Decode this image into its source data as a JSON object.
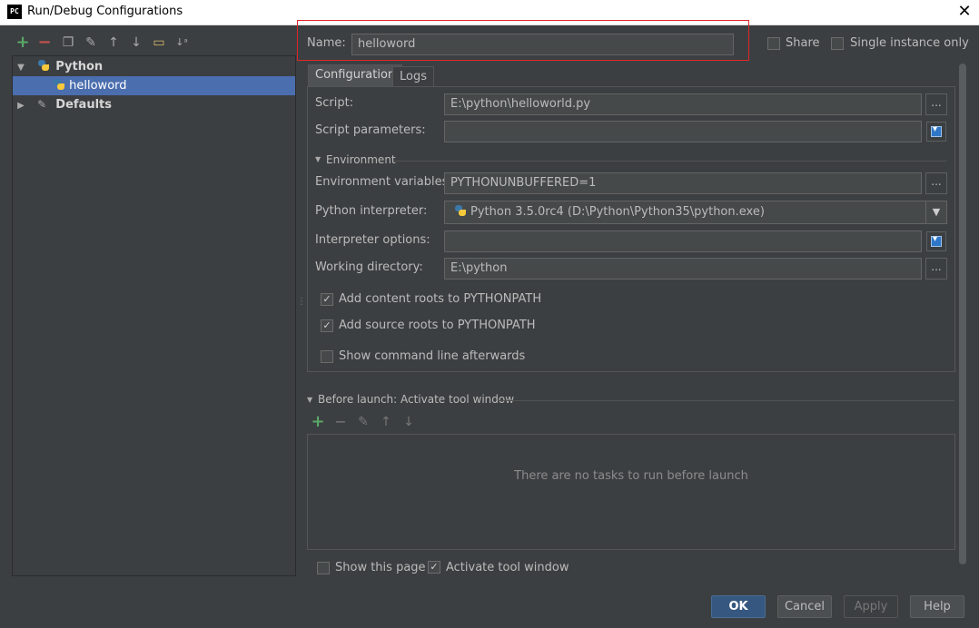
{
  "window": {
    "title": "Run/Debug Configurations",
    "app_icon_text": "PC",
    "close_glyph": "✕"
  },
  "toolbar": {
    "icons": [
      "plus-icon",
      "minus-icon",
      "copy-icon",
      "wrench-icon",
      "arrow-up-icon",
      "arrow-down-icon",
      "folder-icon",
      "sort-icon"
    ]
  },
  "tree": {
    "groups": [
      {
        "label": "Python",
        "expanded": true,
        "icon": "python-icon",
        "children": [
          {
            "label": "helloword",
            "selected": true,
            "icon": "python-icon"
          }
        ]
      },
      {
        "label": "Defaults",
        "expanded": false,
        "icon": "wrench-icon"
      }
    ]
  },
  "header": {
    "name_label": "Name:",
    "name_value": "helloword",
    "share_label": "Share",
    "share_checked": false,
    "single_instance_label": "Single instance only",
    "single_instance_checked": false
  },
  "tabs": [
    {
      "label": "Configuration",
      "active": true
    },
    {
      "label": "Logs",
      "active": false
    }
  ],
  "config": {
    "script_label": "Script:",
    "script_value": "E:\\python\\helloworld.py",
    "script_params_label": "Script parameters:",
    "script_params_value": "",
    "environment_title": "Environment",
    "env_vars_label": "Environment variables:",
    "env_vars_value": "PYTHONUNBUFFERED=1",
    "interpreter_label": "Python interpreter:",
    "interpreter_value": "Python 3.5.0rc4 (D:\\Python\\Python35\\python.exe)",
    "interpreter_options_label": "Interpreter options:",
    "interpreter_options_value": "",
    "working_dir_label": "Working directory:",
    "working_dir_value": "E:\\python",
    "ellipsis": "...",
    "checkboxes": [
      {
        "label": "Add content roots to PYTHONPATH",
        "checked": true
      },
      {
        "label": "Add source roots to PYTHONPATH",
        "checked": true
      },
      {
        "label": "Show command line afterwards",
        "checked": false
      }
    ]
  },
  "before_launch": {
    "title": "Before launch: Activate tool window",
    "empty_text": "There are no tasks to run before launch",
    "toolbar_icons": [
      "plus-icon",
      "minus-icon",
      "edit-icon",
      "arrow-up-icon",
      "arrow-down-icon"
    ]
  },
  "footer": {
    "show_page_label": "Show this page",
    "show_page_checked": false,
    "activate_label": "Activate tool window",
    "activate_checked": true,
    "check_glyph": "✓"
  },
  "buttons": {
    "ok": "OK",
    "cancel": "Cancel",
    "apply": "Apply",
    "help": "Help"
  },
  "colors": {
    "background": "#3c3f41",
    "selection": "#4b6eaf",
    "highlight_box": "#e0262a",
    "add_green": "#59a869",
    "remove_red": "#c75450"
  }
}
